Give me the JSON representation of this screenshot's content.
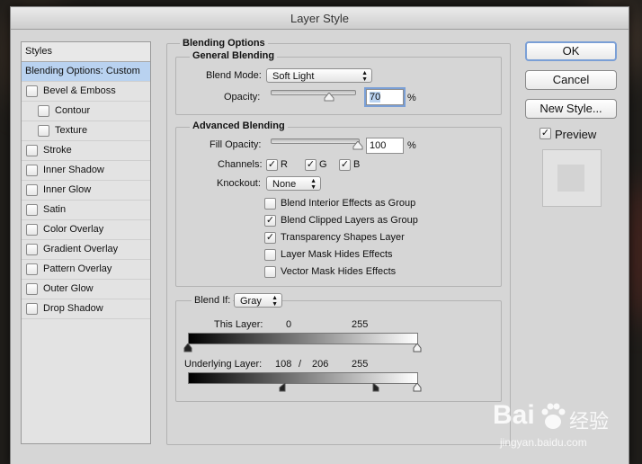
{
  "dialog": {
    "title": "Layer Style"
  },
  "styles": {
    "header": "Styles",
    "items": [
      {
        "label": "Blending Options: Custom",
        "selected": true,
        "checkbox": false,
        "indent": 0
      },
      {
        "label": "Bevel & Emboss",
        "checked": false,
        "checkbox": true,
        "indent": 0
      },
      {
        "label": "Contour",
        "checked": false,
        "checkbox": true,
        "indent": 1
      },
      {
        "label": "Texture",
        "checked": false,
        "checkbox": true,
        "indent": 1
      },
      {
        "label": "Stroke",
        "checked": false,
        "checkbox": true,
        "indent": 0
      },
      {
        "label": "Inner Shadow",
        "checked": false,
        "checkbox": true,
        "indent": 0
      },
      {
        "label": "Inner Glow",
        "checked": false,
        "checkbox": true,
        "indent": 0
      },
      {
        "label": "Satin",
        "checked": false,
        "checkbox": true,
        "indent": 0
      },
      {
        "label": "Color Overlay",
        "checked": false,
        "checkbox": true,
        "indent": 0
      },
      {
        "label": "Gradient Overlay",
        "checked": false,
        "checkbox": true,
        "indent": 0
      },
      {
        "label": "Pattern Overlay",
        "checked": false,
        "checkbox": true,
        "indent": 0
      },
      {
        "label": "Outer Glow",
        "checked": false,
        "checkbox": true,
        "indent": 0
      },
      {
        "label": "Drop Shadow",
        "checked": false,
        "checkbox": true,
        "indent": 0
      }
    ]
  },
  "blending": {
    "section_title": "Blending Options",
    "general": {
      "title": "General Blending",
      "blend_mode_label": "Blend Mode:",
      "blend_mode_value": "Soft Light",
      "opacity_label": "Opacity:",
      "opacity_value": "70",
      "opacity_percent": 0.7,
      "unit": "%"
    },
    "advanced": {
      "title": "Advanced Blending",
      "fill_opacity_label": "Fill Opacity:",
      "fill_opacity_value": "100",
      "fill_opacity_percent": 1.0,
      "unit": "%",
      "channels_label": "Channels:",
      "channels": [
        {
          "label": "R",
          "checked": true
        },
        {
          "label": "G",
          "checked": true
        },
        {
          "label": "B",
          "checked": true
        }
      ],
      "knockout_label": "Knockout:",
      "knockout_value": "None",
      "options": [
        {
          "label": "Blend Interior Effects as Group",
          "checked": false
        },
        {
          "label": "Blend Clipped Layers as Group",
          "checked": true
        },
        {
          "label": "Transparency Shapes Layer",
          "checked": true
        },
        {
          "label": "Layer Mask Hides Effects",
          "checked": false
        },
        {
          "label": "Vector Mask Hides Effects",
          "checked": false
        }
      ]
    },
    "blend_if": {
      "label": "Blend If:",
      "value": "Gray",
      "this_layer_label": "This Layer:",
      "this_layer_low": "0",
      "this_layer_high": "255",
      "underlying_label": "Underlying Layer:",
      "underlying_low_a": "108",
      "underlying_sep": "/",
      "underlying_low_b": "206",
      "underlying_high": "255"
    }
  },
  "buttons": {
    "ok": "OK",
    "cancel": "Cancel",
    "new_style": "New Style...",
    "preview": "Preview",
    "preview_checked": true
  },
  "watermark": {
    "brand": "Bai",
    "brand_cn": "经验",
    "url": "jingyan.baidu.com"
  },
  "colors": {
    "selection": "#b9d2f0",
    "focus": "#7a9fd6",
    "dialog_bg": "#d6d6d6"
  },
  "icons": {
    "check": "check-icon",
    "dropdown": "dropdown-arrows-icon",
    "paw": "baidu-paw-icon"
  }
}
